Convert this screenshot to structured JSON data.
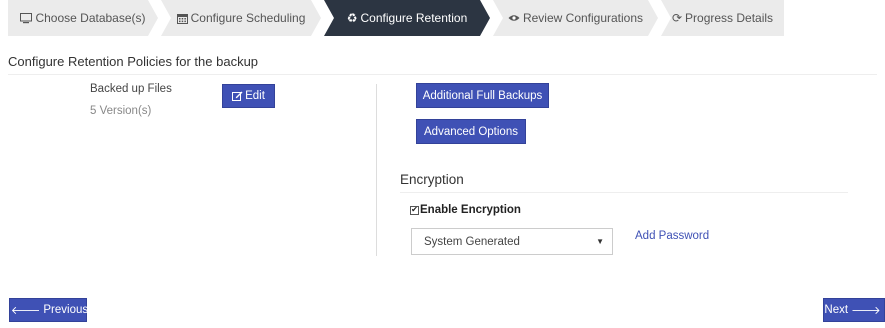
{
  "wizard": {
    "steps": [
      {
        "label": "Choose Database(s)",
        "icon": "monitor-icon",
        "active": false
      },
      {
        "label": "Configure Scheduling",
        "icon": "calendar-icon",
        "active": false
      },
      {
        "label": "Configure Retention",
        "icon": "recycle-icon",
        "active": true
      },
      {
        "label": "Review Configurations",
        "icon": "eye-icon",
        "active": false
      },
      {
        "label": "Progress Details",
        "icon": "refresh-icon",
        "active": false
      }
    ]
  },
  "page": {
    "title": "Configure Retention Policies for the backup"
  },
  "retention": {
    "label": "Backed up Files",
    "value": "5 Version(s)",
    "edit_label": "Edit"
  },
  "actions": {
    "full_backups_label": "Additional Full Backups",
    "advanced_label": "Advanced Options"
  },
  "encryption": {
    "title": "Encryption",
    "checkbox_label": "Enable Encryption",
    "checked": true,
    "selected_option": "System Generated",
    "add_password_label": "Add Password"
  },
  "nav": {
    "previous_label": "Previous",
    "next_label": "Next"
  },
  "colors": {
    "primary": "#3f51b5",
    "active_step": "#2c3542",
    "inactive_step": "#ebebeb"
  }
}
